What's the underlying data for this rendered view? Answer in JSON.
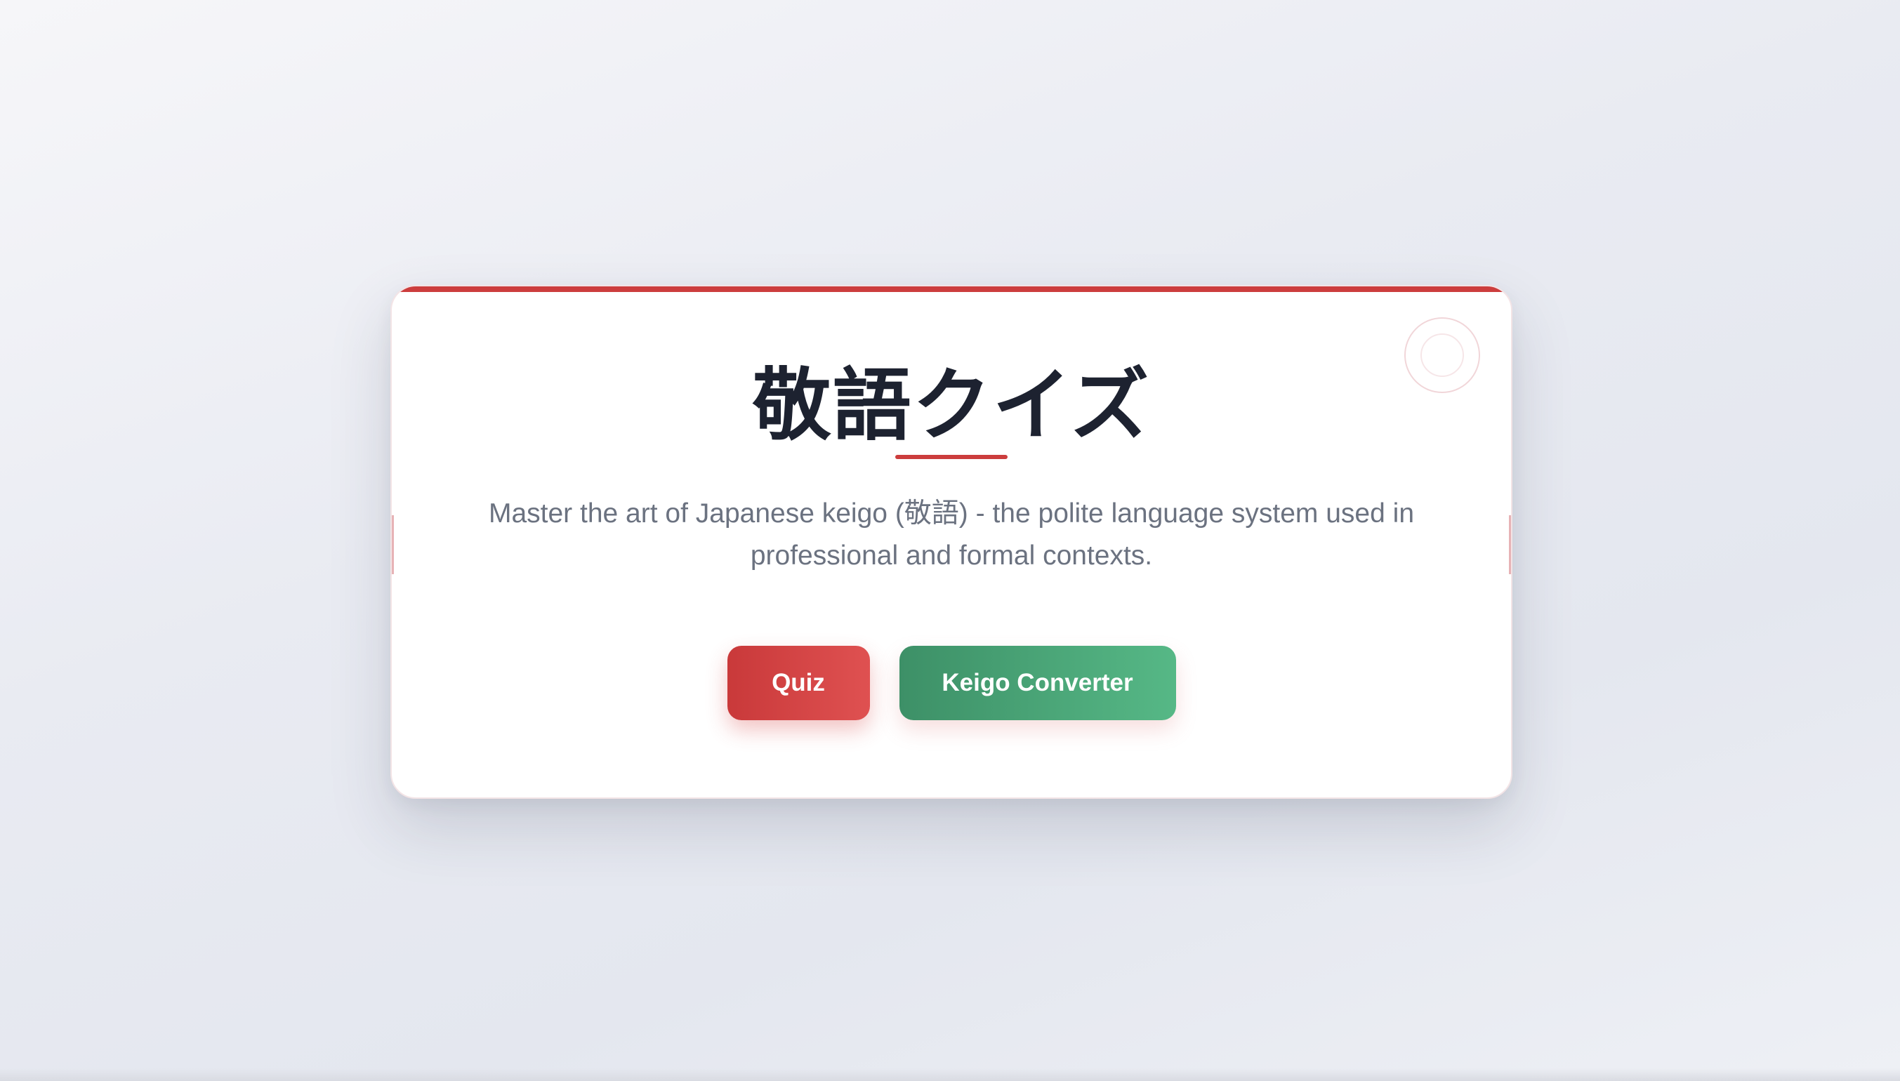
{
  "card": {
    "title": "敬語クイズ",
    "description": "Master the art of Japanese keigo (敬語) - the polite language system used in professional and formal contexts."
  },
  "actions": {
    "quiz_label": "Quiz",
    "converter_label": "Keigo Converter"
  },
  "colors": {
    "accent_red": "#cc3d3d",
    "accent_green": "#4aa677",
    "title_text": "#1d2230",
    "body_text": "#6b7280"
  },
  "icons": {
    "decoration": "circle-ring-icon"
  }
}
